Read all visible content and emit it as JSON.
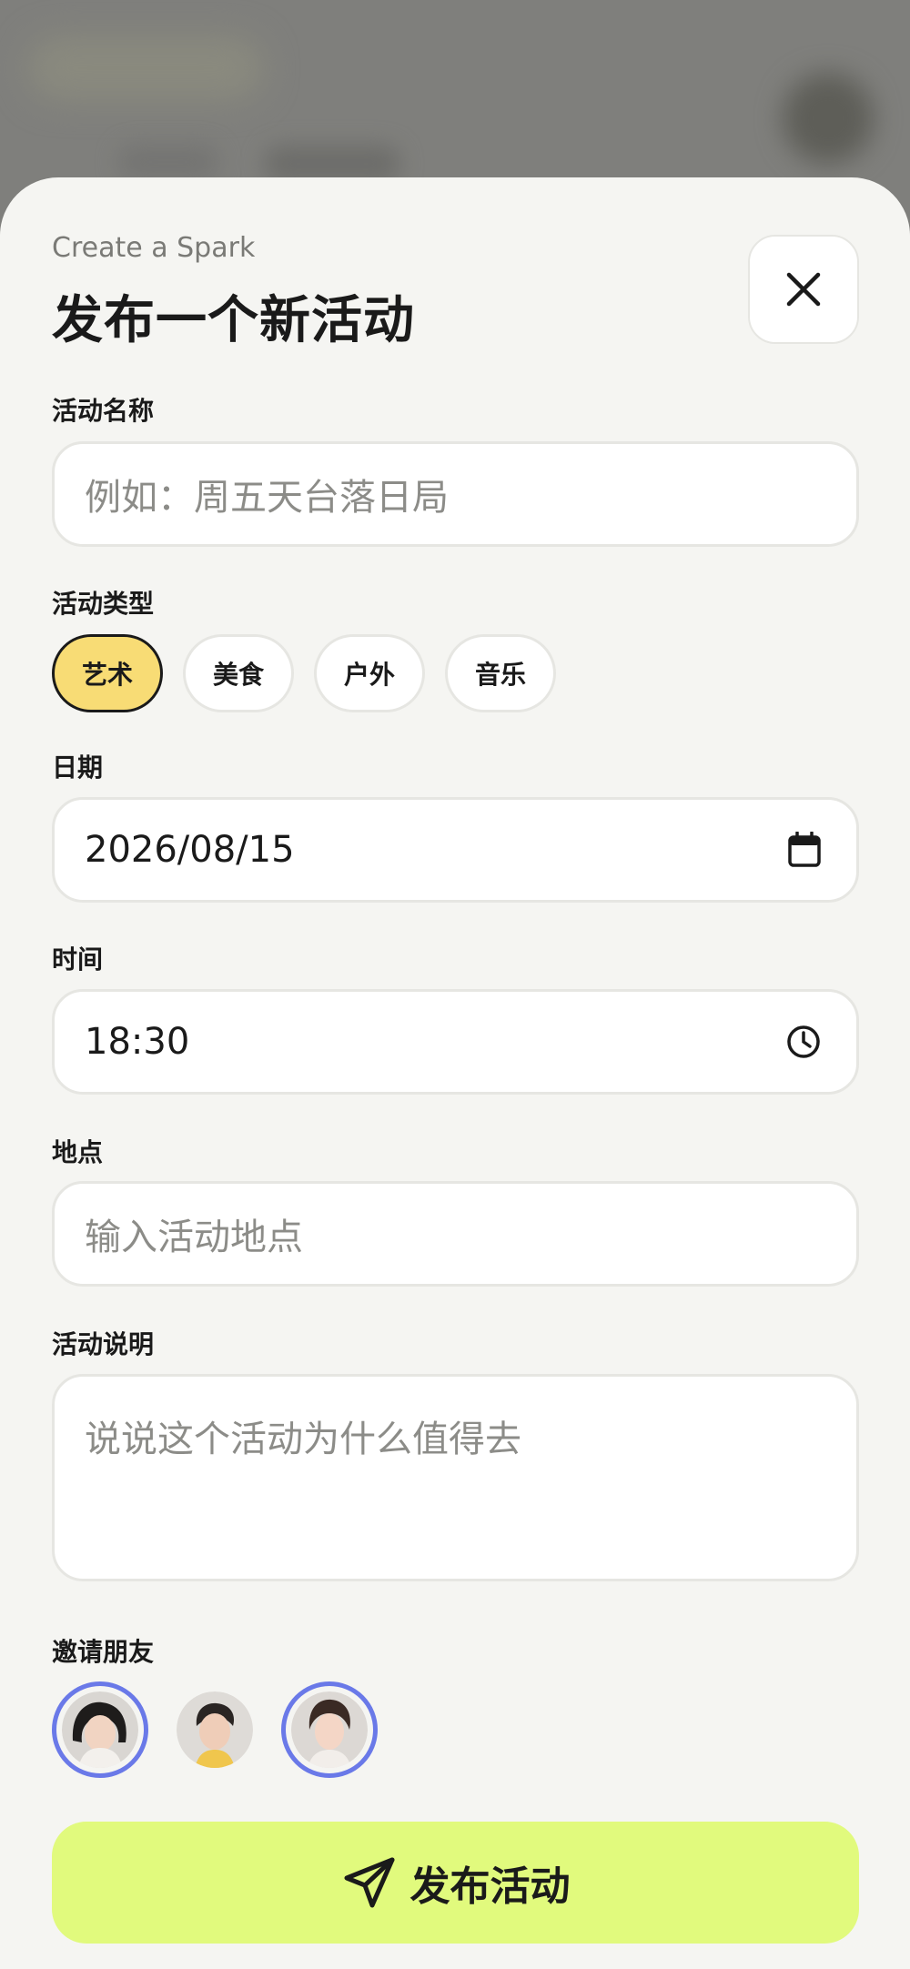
{
  "header": {
    "eyebrow": "Create a Spark",
    "title": "发布一个新活动"
  },
  "form": {
    "name": {
      "label": "活动名称",
      "placeholder": "例如：周五天台落日局"
    },
    "category": {
      "label": "活动类型",
      "options": [
        "艺术",
        "美食",
        "户外",
        "音乐"
      ],
      "selected": "艺术"
    },
    "date": {
      "label": "日期",
      "value": "2026/08/15",
      "icon": "calendar-icon"
    },
    "time": {
      "label": "时间",
      "value": "18:30",
      "icon": "clock-icon"
    },
    "location": {
      "label": "地点",
      "placeholder": "输入活动地点"
    },
    "description": {
      "label": "活动说明",
      "placeholder": "说说这个活动为什么值得去"
    },
    "invite": {
      "label": "邀请朋友",
      "friends": [
        {
          "selected": true
        },
        {
          "selected": false
        },
        {
          "selected": true
        }
      ]
    }
  },
  "actions": {
    "publish_label": "发布活动",
    "publish_icon": "send-icon",
    "close_icon": "close-icon"
  },
  "colors": {
    "accent": "#e1fa7d",
    "chip_selected": "#f8dc75",
    "avatar_ring": "#6a79e8"
  }
}
